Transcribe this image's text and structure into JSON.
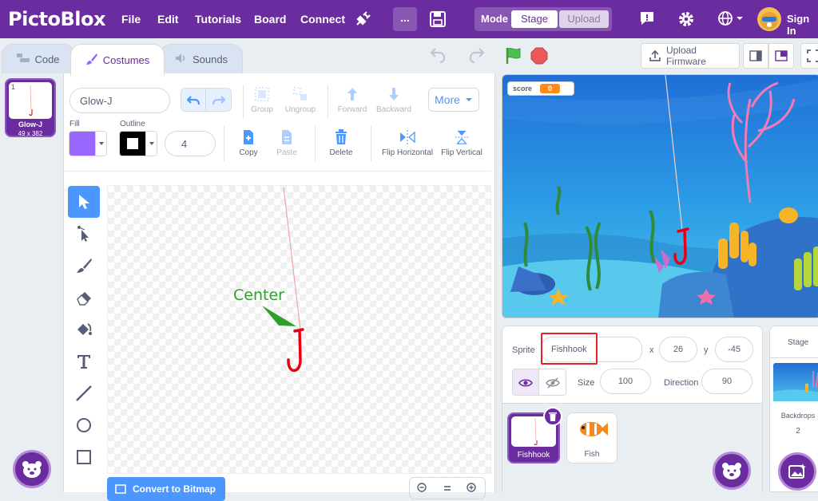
{
  "app": {
    "logo": "PictoBlox"
  },
  "menu": {
    "file": "File",
    "edit": "Edit",
    "tutorials": "Tutorials",
    "board": "Board",
    "connect": "Connect",
    "more": "...",
    "mode_label": "Mode",
    "stage": "Stage",
    "upload": "Upload",
    "sign_in": "Sign In"
  },
  "tabs": {
    "code": "Code",
    "costumes": "Costumes",
    "sounds": "Sounds"
  },
  "costume_list": [
    {
      "index": "1",
      "name": "Glow-J",
      "size": "49 x 382"
    }
  ],
  "paint": {
    "costume_name": "Glow-J",
    "more_label": "More",
    "fill_label": "Fill",
    "outline_label": "Outline",
    "outline_width": "4",
    "fill_color": "#9966ff",
    "group": "Group",
    "ungroup": "Ungroup",
    "forward": "Forward",
    "backward": "Backward",
    "copy": "Copy",
    "paste": "Paste",
    "delete": "Delete",
    "flip_h": "Flip Horizontal",
    "flip_v": "Flip Vertical",
    "center_annotation": "Center",
    "convert_button": "Convert to Bitmap"
  },
  "stage_bar": {
    "upload_firmware": "Upload Firmware"
  },
  "stage": {
    "score_label": "score",
    "score_value": "0"
  },
  "sprite_info": {
    "sprite_label": "Sprite",
    "sprite_name": "Fishhook",
    "x_label": "x",
    "x_value": "26",
    "y_label": "y",
    "y_value": "-45",
    "size_label": "Size",
    "size_value": "100",
    "direction_label": "Direction",
    "direction_value": "90"
  },
  "sprites": [
    {
      "name": "Fishhook"
    },
    {
      "name": "Fish"
    }
  ],
  "stage_panel": {
    "title": "Stage",
    "backdrops_label": "Backdrops",
    "backdrops_count": "2"
  },
  "colors": {
    "brand": "#6b2ca0",
    "accent": "#4c97ff",
    "highlight_box": "#e5212a"
  }
}
